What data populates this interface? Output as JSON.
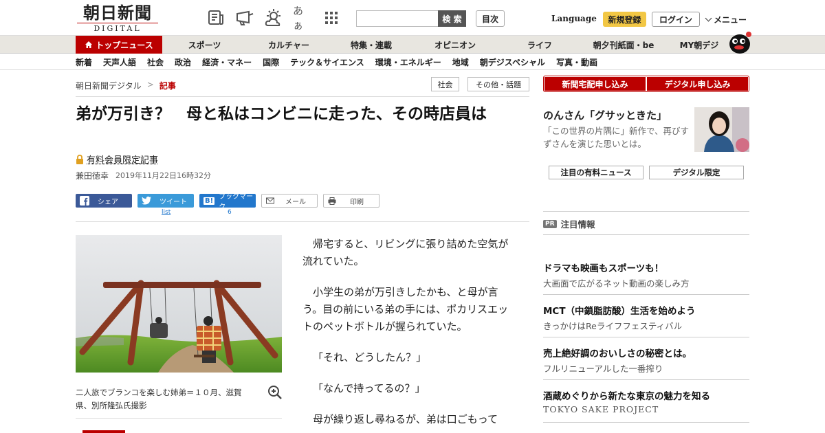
{
  "header": {
    "logo_main": "朝日新聞",
    "logo_sub": "DIGITAL",
    "icons": [
      "newspaper-icon",
      "megaphone-icon",
      "weather-icon",
      "font-size-icon",
      "grid-icon"
    ],
    "font_size_label": "あぁ",
    "search_placeholder": "",
    "search_button": "検 索",
    "toc_button": "目次",
    "language": "Language",
    "register": "新規登録",
    "login": "ログイン",
    "menu": "メニュー"
  },
  "mainnav": {
    "items": [
      "トップニュース",
      "スポーツ",
      "カルチャー",
      "特集・連載",
      "オピニオン",
      "ライフ",
      "朝夕刊紙面・be",
      "MY朝デジ"
    ]
  },
  "subnav": {
    "items": [
      "新着",
      "天声人語",
      "社会",
      "政治",
      "経済・マネー",
      "国際",
      "テック＆サイエンス",
      "環境・エネルギー",
      "地域",
      "朝デジスペシャル",
      "写真・動画"
    ]
  },
  "breadcrumb": {
    "home": "朝日新聞デジタル",
    "sep": ">",
    "current": "記事"
  },
  "tags": [
    "社会",
    "その他・話題"
  ],
  "article": {
    "title": "弟が万引き？　母と私はコンビニに走った、その時店員は",
    "members_label": "有料会員限定記事",
    "author": "兼田徳幸",
    "date": "2019年11月22日16時32分",
    "caption": "二人旅でブランコを楽しむ姉弟＝１０月、滋賀県、別所隆弘氏撮影",
    "paragraphs": [
      "帰宅すると、リビングに張り詰めた空気が流れていた。",
      "小学生の弟が万引きしたかも、と母が言う。目の前にいる弟の手には、ポカリスエットのペットボトルが握られていた。",
      "「それ、どうしたん？」",
      "「なんで持ってるの？」",
      "母が繰り返し尋ねるが、弟は口ごもって"
    ]
  },
  "share": {
    "facebook": "シェア",
    "twitter": "ツイート",
    "twitter_count": "list",
    "hatena": "ブックマーク",
    "hatena_count": "6",
    "mail": "メール",
    "print": "印刷"
  },
  "sidebar": {
    "subscribe_paper": "新聞宅配申し込み",
    "subscribe_digital": "デジタル申し込み",
    "feature_title": "のんさん「グサッときた」",
    "feature_desc": "「この世界の片隅に」新作で、再びすずさんを演じた思いとは。",
    "btn_paid_news": "注目の有料ニュース",
    "btn_digital_only": "デジタル限定",
    "pr_badge": "PR",
    "pr_heading": "注目情報",
    "ads": [
      {
        "title": "ドラマも映画もスポーツも！",
        "desc": "大画面で広がるネット動画の楽しみ方"
      },
      {
        "title": "MCT（中鎖脂肪酸）生活を始めよう",
        "desc": "きっかけはReライフフェスティバル"
      },
      {
        "title": "売上絶好調のおいしさの秘密とは。",
        "desc": "フルリニューアルした一番搾り"
      },
      {
        "title": "酒蔵めぐりから新たな東京の魅力を知る",
        "desc": "TOKYO SAKE PROJECT"
      }
    ]
  },
  "colors": {
    "brand_red": "#bb0000",
    "register_yellow": "#f2c744",
    "facebook": "#3b5998",
    "twitter": "#3a9ad9",
    "hatena": "#2277cc"
  }
}
